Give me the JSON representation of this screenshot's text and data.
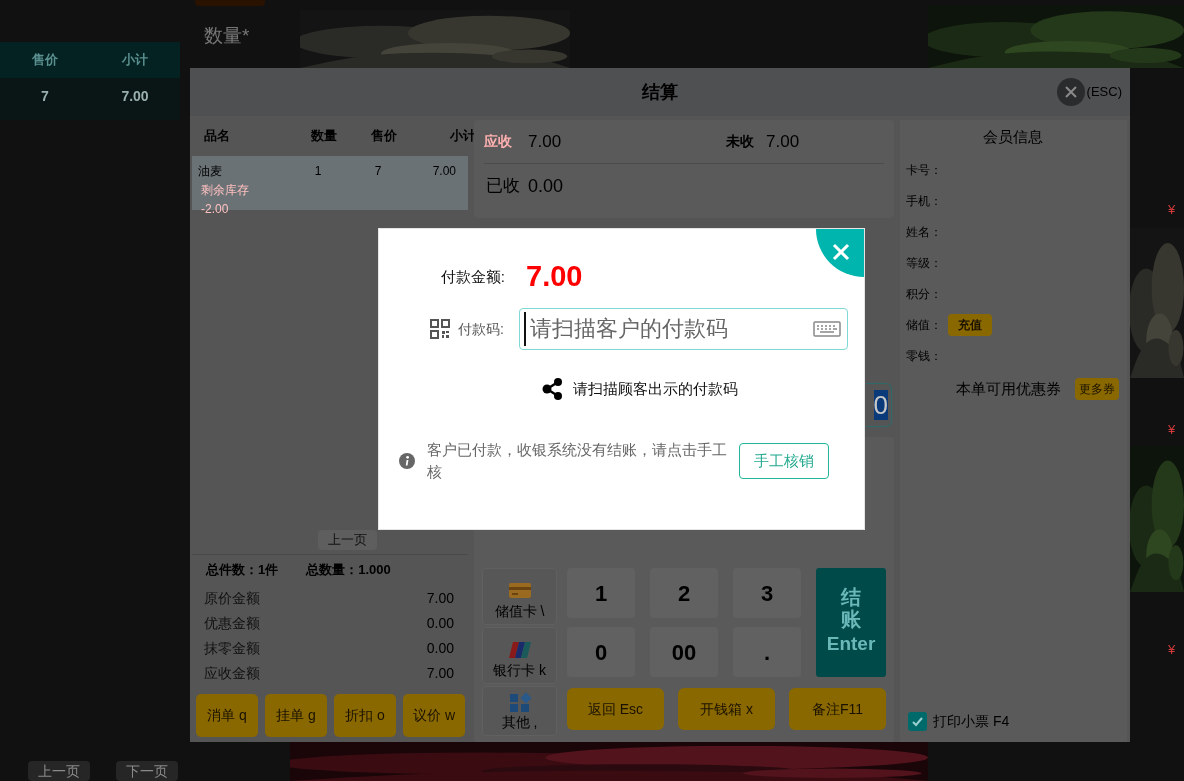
{
  "background": {
    "columns": [
      "售价",
      "小计"
    ],
    "row": [
      "7",
      "7.00"
    ],
    "quantity_label": "数量*",
    "pager": [
      "上一页",
      "下一页"
    ],
    "price_marks": [
      "¥",
      "¥",
      "¥"
    ]
  },
  "settlement": {
    "title": "结算",
    "close_hint": "(ESC)",
    "items": {
      "columns": [
        "品名",
        "数量",
        "售价",
        "小计"
      ],
      "rows": [
        {
          "name": "油麦",
          "stock_note": "剩余库存",
          "stock": "-2.00",
          "quantity": "1",
          "price": "7",
          "subtotal": "7.00",
          "selected": true
        }
      ]
    },
    "pager": [
      "上一页"
    ],
    "totals": [
      {
        "label": "总件数：",
        "value": "1件"
      },
      {
        "label": "总数量：",
        "value": "1.000"
      }
    ],
    "amounts": [
      {
        "label": "原价金额",
        "value": "7.00"
      },
      {
        "label": "优惠金额",
        "value": "0.00"
      },
      {
        "label": "抹零金额",
        "value": "0.00"
      },
      {
        "label": "应收金额",
        "value": "7.00"
      }
    ],
    "actions": [
      "消单 q",
      "挂单 g",
      "折扣 o",
      "议价 w"
    ],
    "receivable": {
      "label": "应收",
      "value": "7.00"
    },
    "unpaid": {
      "label": "未收",
      "value": "7.00"
    },
    "received": {
      "label": "已收",
      "value": "0.00"
    },
    "tendered_field": {
      "value": "0"
    },
    "methods": [
      {
        "label": "储值卡 \\",
        "kind": "card"
      },
      {
        "label": "银行卡 k",
        "kind": "bank"
      },
      {
        "label": "其他 ,",
        "kind": "other"
      }
    ],
    "keypad": [
      [
        "1",
        "2",
        "3"
      ],
      [
        "0",
        "00",
        "."
      ]
    ],
    "checkout": {
      "label": "结账",
      "key": "Enter"
    },
    "bottom_buttons": [
      "返回 Esc",
      "开钱箱 x",
      "备注F11"
    ],
    "member": {
      "title": "会员信息",
      "fields": [
        {
          "label": "卡号："
        },
        {
          "label": "手机："
        },
        {
          "label": "姓名："
        },
        {
          "label": "等级："
        },
        {
          "label": "积分："
        },
        {
          "label": "储值：",
          "action": "充值"
        },
        {
          "label": "零钱："
        }
      ],
      "coupons": {
        "label": "本单可用优惠券",
        "action": "更多券"
      },
      "print_receipt": {
        "label": "打印小票 F4",
        "checked": true
      }
    }
  },
  "payment": {
    "amount_label": "付款金额:",
    "amount": "7.00",
    "code_label": "付款码:",
    "code_placeholder": "请扫描客户的付款码",
    "scan_hint": "请扫描顾客出示的付款码",
    "notice": "客户已付款，收银系统没有结账，请点击手工核",
    "manual_button": "手工核销"
  }
}
